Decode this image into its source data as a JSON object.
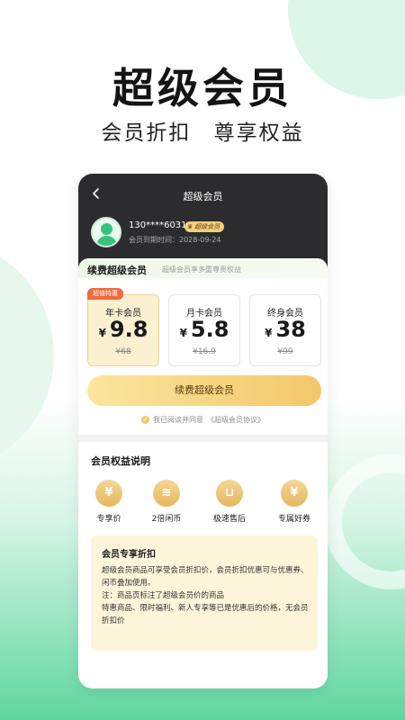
{
  "headline": "超级会员",
  "subline": [
    "会员折扣",
    "尊享权益"
  ],
  "phone": {
    "nav_title": "超级会员",
    "user": {
      "phone": "130****6031",
      "badge": "超级会员",
      "expire": "会员到期时间：2028-09-24"
    },
    "renew": {
      "title": "续费超级会员",
      "subtitle": "超级会员享多重尊贵权益",
      "tag": "超值特惠",
      "currency": "¥",
      "plans": [
        {
          "name": "年卡会员",
          "price": "9.8",
          "original": "¥68",
          "selected": true
        },
        {
          "name": "月卡会员",
          "price": "5.8",
          "original": "¥16.9",
          "selected": false
        },
        {
          "name": "终身会员",
          "price": "38",
          "original": "¥99",
          "selected": false
        }
      ],
      "button": "续费超级会员",
      "agree_text": "我已阅读并同意",
      "agree_link": "《超级会员协议》"
    },
    "benefits": {
      "title": "会员权益说明",
      "items": [
        {
          "label": "专享价",
          "icon": "yen-icon"
        },
        {
          "label": "2倍闲币",
          "icon": "coins-icon"
        },
        {
          "label": "极速售后",
          "icon": "basket-icon"
        },
        {
          "label": "专属好券",
          "icon": "coupon-bag-icon"
        }
      ],
      "detail": {
        "title": "会员专享折扣",
        "lines": [
          "超级会员商品可享受会员折扣价，会员折扣优惠可与优惠券、闲币叠加使用。",
          "注：商品页标注了超级会员价的商品",
          "特惠商品、限时福利、新人专享等已是优惠后的价格，无会员折扣价"
        ]
      }
    }
  },
  "colors": {
    "accent_gold": "#f3c76a",
    "header_dark": "#2c2c2e",
    "tag_orange": "#f06a3d",
    "avatar_green": "#37c47a"
  }
}
